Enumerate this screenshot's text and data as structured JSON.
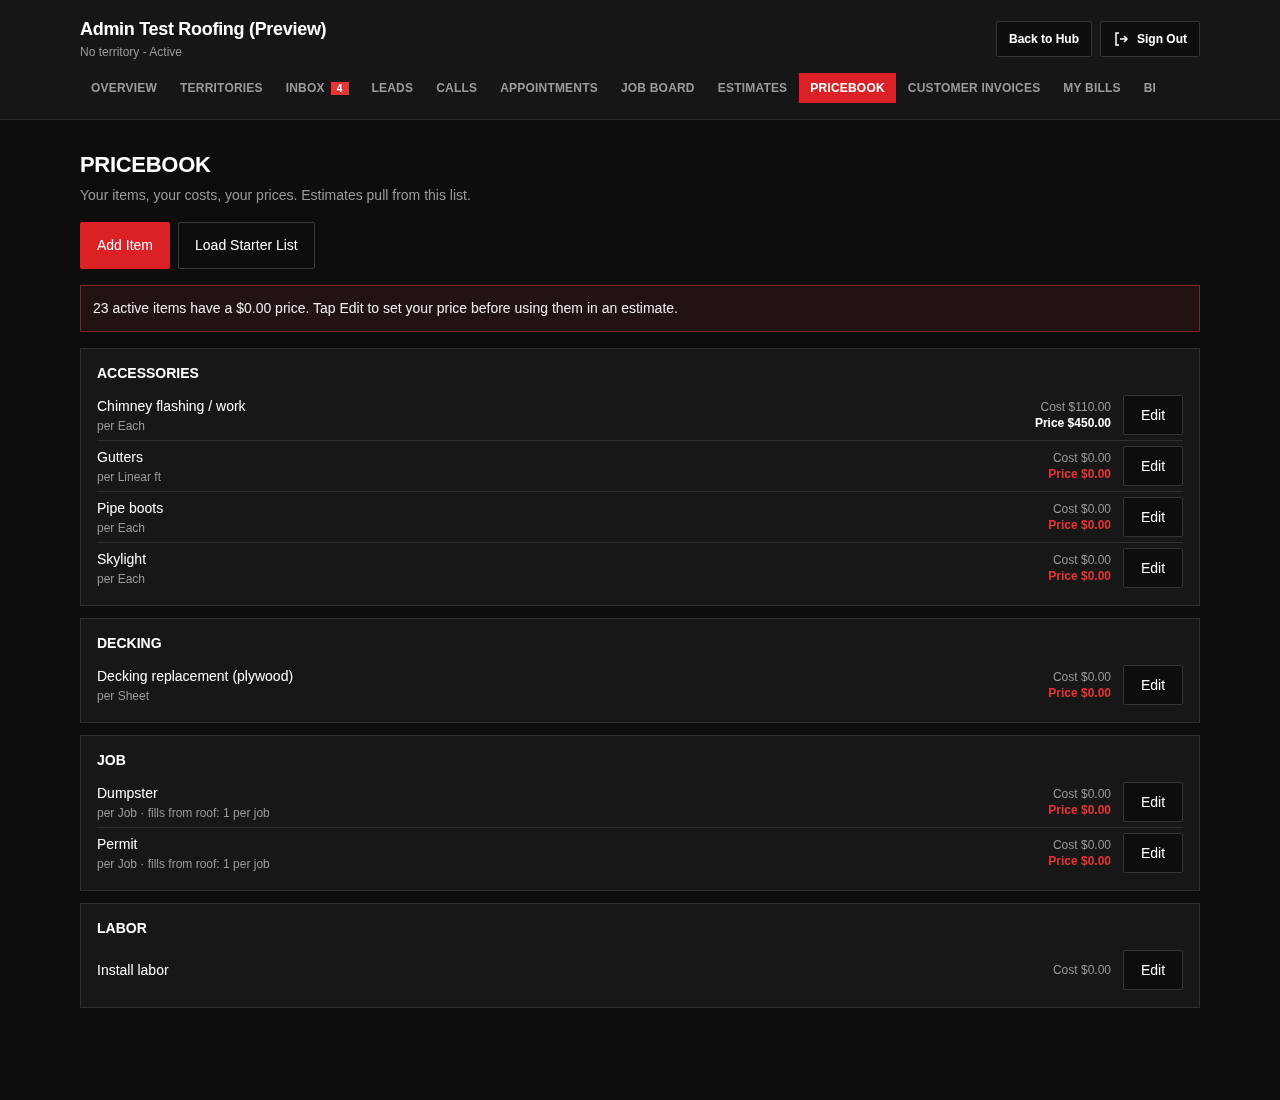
{
  "header": {
    "title": "Admin Test Roofing (Preview)",
    "subtitle": "No territory - Active",
    "buttons": [
      {
        "kind": "hub",
        "label": "Back to Hub"
      },
      {
        "kind": "signout",
        "label": "Sign Out"
      }
    ]
  },
  "tabs": [
    {
      "label": "OVERVIEW",
      "selected": false
    },
    {
      "label": "TERRITORIES",
      "selected": false
    },
    {
      "label": "INBOX",
      "selected": false,
      "badge": "4"
    },
    {
      "label": "LEADS",
      "selected": false
    },
    {
      "label": "CALLS",
      "selected": false
    },
    {
      "label": "APPOINTMENTS",
      "selected": false
    },
    {
      "label": "JOB BOARD",
      "selected": false
    },
    {
      "label": "ESTIMATES",
      "selected": false
    },
    {
      "label": "PRICEBOOK",
      "selected": true
    },
    {
      "label": "CUSTOMER INVOICES",
      "selected": false
    },
    {
      "label": "MY BILLS",
      "selected": false
    },
    {
      "label": "BI",
      "selected": false
    }
  ],
  "page": {
    "title": "PRICEBOOK",
    "subtitle": "Your items, your costs, your prices. Estimates pull from this list.",
    "actions": [
      {
        "kind": "primary",
        "label": "Add Item"
      },
      {
        "kind": "secondary",
        "label": "Load Starter List"
      }
    ],
    "alert": "23 active items have a $0.00 price. Tap Edit to set your price before using them in an estimate."
  },
  "categories": [
    {
      "title": "ACCESSORIES",
      "items": [
        {
          "name": "Chimney flashing / work",
          "unit": "per Each",
          "cost": "Cost $110.00",
          "price": "Price $450.00",
          "missing_price": false,
          "edit": "Edit"
        },
        {
          "name": "Gutters",
          "unit": "per Linear ft",
          "cost": "Cost $0.00",
          "price": "Price $0.00",
          "missing_price": true,
          "edit": "Edit"
        },
        {
          "name": "Pipe boots",
          "unit": "per Each",
          "cost": "Cost $0.00",
          "price": "Price $0.00",
          "missing_price": true,
          "edit": "Edit"
        },
        {
          "name": "Skylight",
          "unit": "per Each",
          "cost": "Cost $0.00",
          "price": "Price $0.00",
          "missing_price": true,
          "edit": "Edit"
        }
      ]
    },
    {
      "title": "DECKING",
      "items": [
        {
          "name": "Decking replacement (plywood)",
          "unit": "per Sheet",
          "cost": "Cost $0.00",
          "price": "Price $0.00",
          "missing_price": true,
          "edit": "Edit"
        }
      ]
    },
    {
      "title": "JOB",
      "items": [
        {
          "name": "Dumpster",
          "unit": "per Job · fills from roof: 1 per job",
          "cost": "Cost $0.00",
          "price": "Price $0.00",
          "missing_price": true,
          "edit": "Edit"
        },
        {
          "name": "Permit",
          "unit": "per Job · fills from roof: 1 per job",
          "cost": "Cost $0.00",
          "price": "Price $0.00",
          "missing_price": true,
          "edit": "Edit"
        }
      ]
    },
    {
      "title": "LABOR",
      "items": [
        {
          "name": "Install labor",
          "cost": "Cost $0.00",
          "edit": "Edit"
        }
      ]
    }
  ]
}
